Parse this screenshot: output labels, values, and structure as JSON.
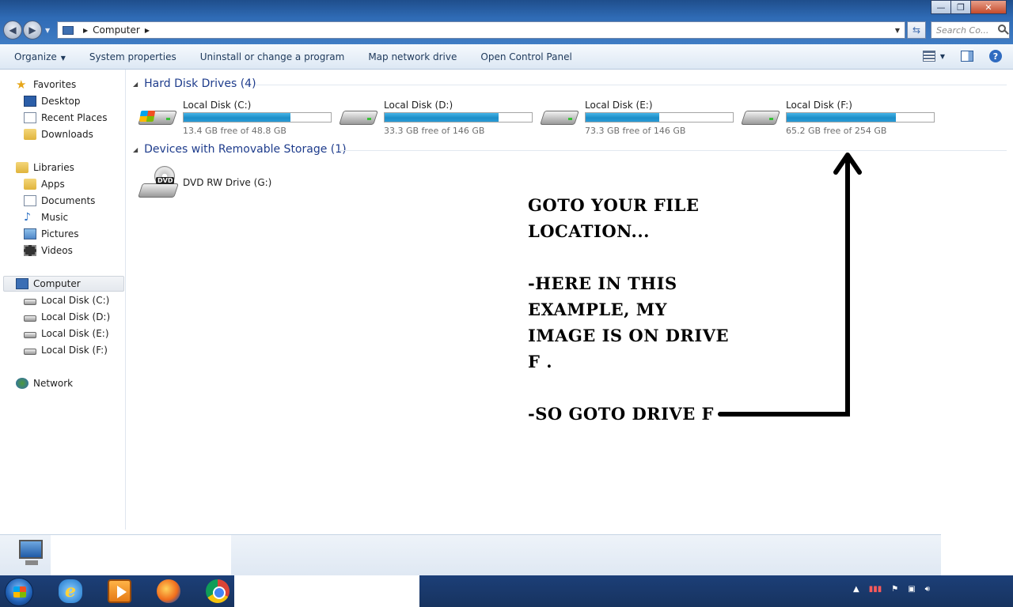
{
  "window": {
    "controls": {
      "minimize": "—",
      "maximize": "❐",
      "close": "✕"
    }
  },
  "address": {
    "path": [
      "Computer"
    ],
    "search_placeholder": "Search Co..."
  },
  "toolbar": {
    "organize": "Organize",
    "system_properties": "System properties",
    "uninstall": "Uninstall or change a program",
    "map_network": "Map network drive",
    "control_panel": "Open Control Panel",
    "help": "?"
  },
  "sidebar": {
    "favorites": {
      "label": "Favorites",
      "items": [
        "Desktop",
        "Recent Places",
        "Downloads"
      ]
    },
    "libraries": {
      "label": "Libraries",
      "items": [
        "Apps",
        "Documents",
        "Music",
        "Pictures",
        "Videos"
      ]
    },
    "computer": {
      "label": "Computer",
      "items": [
        "Local Disk (C:)",
        "Local Disk (D:)",
        "Local Disk (E:)",
        "Local Disk (F:)"
      ]
    },
    "network": {
      "label": "Network"
    }
  },
  "groups": {
    "hard_disks": {
      "title": "Hard Disk Drives (4)",
      "drives": [
        {
          "name": "Local Disk (C:)",
          "free": "13.4 GB free of 48.8 GB",
          "used_fraction": 0.725
        },
        {
          "name": "Local Disk (D:)",
          "free": "33.3 GB free of 146 GB",
          "used_fraction": 0.772
        },
        {
          "name": "Local Disk (E:)",
          "free": "73.3 GB free of 146 GB",
          "used_fraction": 0.498
        },
        {
          "name": "Local Disk (F:)",
          "free": "65.2 GB free of 254 GB",
          "used_fraction": 0.743
        }
      ]
    },
    "removable": {
      "title": "Devices with Removable Storage (1)",
      "devices": [
        {
          "name": "DVD RW Drive (G:)",
          "icon_label": "DVD"
        }
      ]
    }
  },
  "annotation": {
    "lines": [
      "GOTO YOUR FILE",
      "LOCATION...",
      "",
      "-HERE IN THIS",
      "EXAMPLE, MY",
      "IMAGE IS ON DRIVE",
      "F .",
      "",
      "-SO GOTO DRIVE F"
    ]
  },
  "colors": {
    "accent": "#1e3c8c",
    "bar_fill": "#1d8ec8",
    "taskbar": "#17335f"
  }
}
